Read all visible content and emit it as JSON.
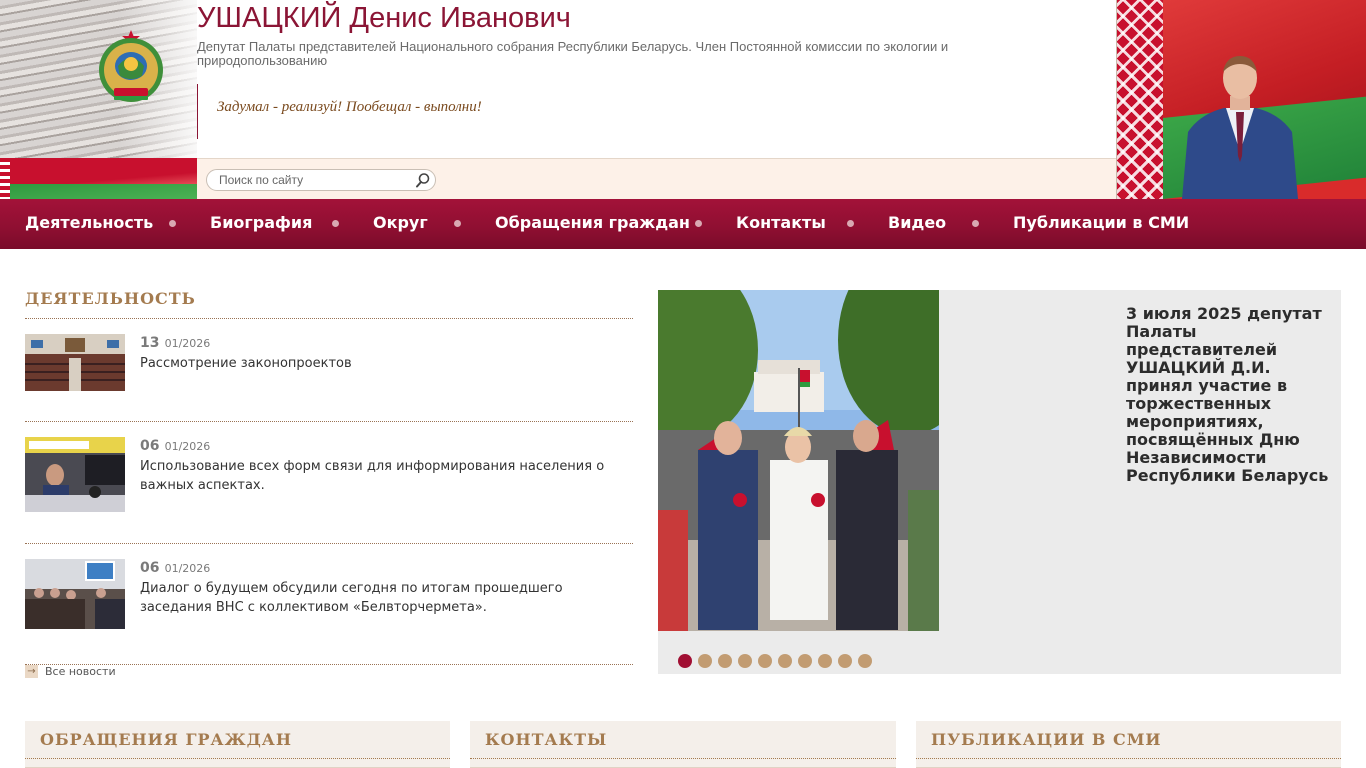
{
  "header": {
    "name": "УШАЦКИЙ Денис Иванович",
    "subtitle": "Депутат Палаты представителей Национального собрания Республики Беларусь. Член Постоянной комиссии по экологии и природопользованию",
    "slogan": "Задумал - реализуй! Пообещал - выполни!",
    "search": {
      "placeholder": "Поиск по сайту",
      "icon": "magnifier"
    }
  },
  "nav": {
    "items": [
      {
        "label": "Деятельность"
      },
      {
        "label": "Биография"
      },
      {
        "label": "Округ"
      },
      {
        "label": "Обращения граждан"
      },
      {
        "label": "Контакты"
      },
      {
        "label": "Видео"
      },
      {
        "label": "Публикации в СМИ"
      }
    ]
  },
  "news": {
    "title": "ДЕЯТЕЛЬНОСТЬ",
    "items": [
      {
        "day": "13",
        "month": "01/2026",
        "text": "Рассмотрение законопроектов"
      },
      {
        "day": "06",
        "month": "01/2026",
        "text": "Использование всех форм связи для информирования населения о важных аспектах."
      },
      {
        "day": "06",
        "month": "01/2026",
        "text": "Диалог о будущем обсудили сегодня по итогам прошедшего заседания ВНС с коллективом «Белвторчермета»."
      }
    ],
    "all_news": "Все новости"
  },
  "slider": {
    "caption": "3 июля 2025 депутат Палаты представителей УШАЦКИЙ Д.И. принял участие в торжественных мероприятиях, посвящённых Дню Независимости Республики Беларусь",
    "dot_count": 10,
    "active_index": 0
  },
  "sections": {
    "appeals": "ОБРАЩЕНИЯ ГРАЖДАН",
    "contacts": "КОНТАКТЫ",
    "publications": "ПУБЛИКАЦИИ В СМИ"
  },
  "colors": {
    "accent": "#8b1535",
    "nav_bg": "#8e0f31",
    "section_title": "#a47b4f",
    "slider_bg": "#ebebeb",
    "dot": "#c29c72",
    "dot_active": "#a10f33"
  }
}
